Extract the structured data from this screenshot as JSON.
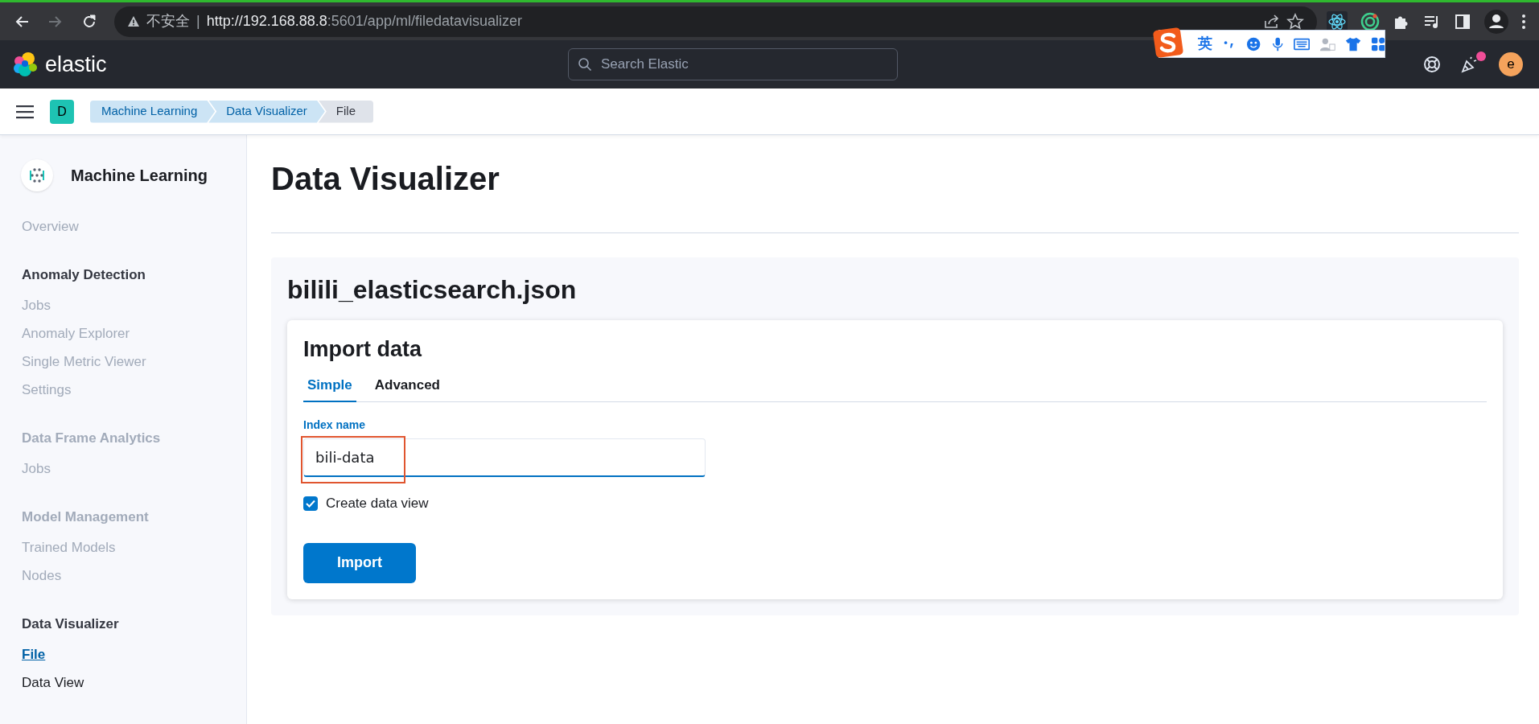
{
  "browser": {
    "nav": [
      {
        "kind": "back",
        "disabled": false
      },
      {
        "kind": "forward",
        "disabled": true
      },
      {
        "kind": "reload",
        "disabled": false
      }
    ],
    "security_label": "不安全",
    "separator": "|",
    "url_host": "http://192.168.88.8",
    "url_path": ":5601/app/ml/filedatavisualizer"
  },
  "ime_toolbar": {
    "mode": "英"
  },
  "header": {
    "brand": "elastic",
    "search": {
      "placeholder": "Search Elastic"
    },
    "news_unread": true,
    "avatar": "e"
  },
  "breadcrumbs": {
    "space": "D",
    "items": [
      {
        "label": "Machine Learning",
        "current": false
      },
      {
        "label": "Data Visualizer",
        "current": false
      },
      {
        "label": "File",
        "current": true
      }
    ]
  },
  "sidebar": {
    "title": "Machine Learning",
    "sections": [
      {
        "items": [
          {
            "label": "Overview",
            "disabled": true,
            "selected": false
          }
        ]
      },
      {
        "title": "Anomaly Detection",
        "disabled": false,
        "items": [
          {
            "label": "Jobs",
            "disabled": true,
            "selected": false
          },
          {
            "label": "Anomaly Explorer",
            "disabled": true,
            "selected": false
          },
          {
            "label": "Single Metric Viewer",
            "disabled": true,
            "selected": false
          },
          {
            "label": "Settings",
            "disabled": true,
            "selected": false
          }
        ]
      },
      {
        "title": "Data Frame Analytics",
        "disabled": true,
        "items": [
          {
            "label": "Jobs",
            "disabled": true,
            "selected": false
          }
        ]
      },
      {
        "title": "Model Management",
        "disabled": true,
        "items": [
          {
            "label": "Trained Models",
            "disabled": true,
            "selected": false
          },
          {
            "label": "Nodes",
            "disabled": true,
            "selected": false
          }
        ]
      },
      {
        "title": "Data Visualizer",
        "disabled": false,
        "items": [
          {
            "label": "File",
            "disabled": false,
            "selected": true
          },
          {
            "label": "Data View",
            "disabled": false,
            "selected": false
          }
        ]
      }
    ]
  },
  "page": {
    "title": "Data Visualizer",
    "file_name": "bilili_elasticsearch.json",
    "import_card": {
      "title": "Import data",
      "tabs": [
        {
          "label": "Simple",
          "selected": true
        },
        {
          "label": "Advanced",
          "selected": false
        }
      ],
      "index_field": {
        "label": "Index name",
        "value": "bili-data",
        "focused": true,
        "highlighted": true
      },
      "checkbox": {
        "label": "Create data view",
        "checked": true
      },
      "button": "Import"
    }
  }
}
